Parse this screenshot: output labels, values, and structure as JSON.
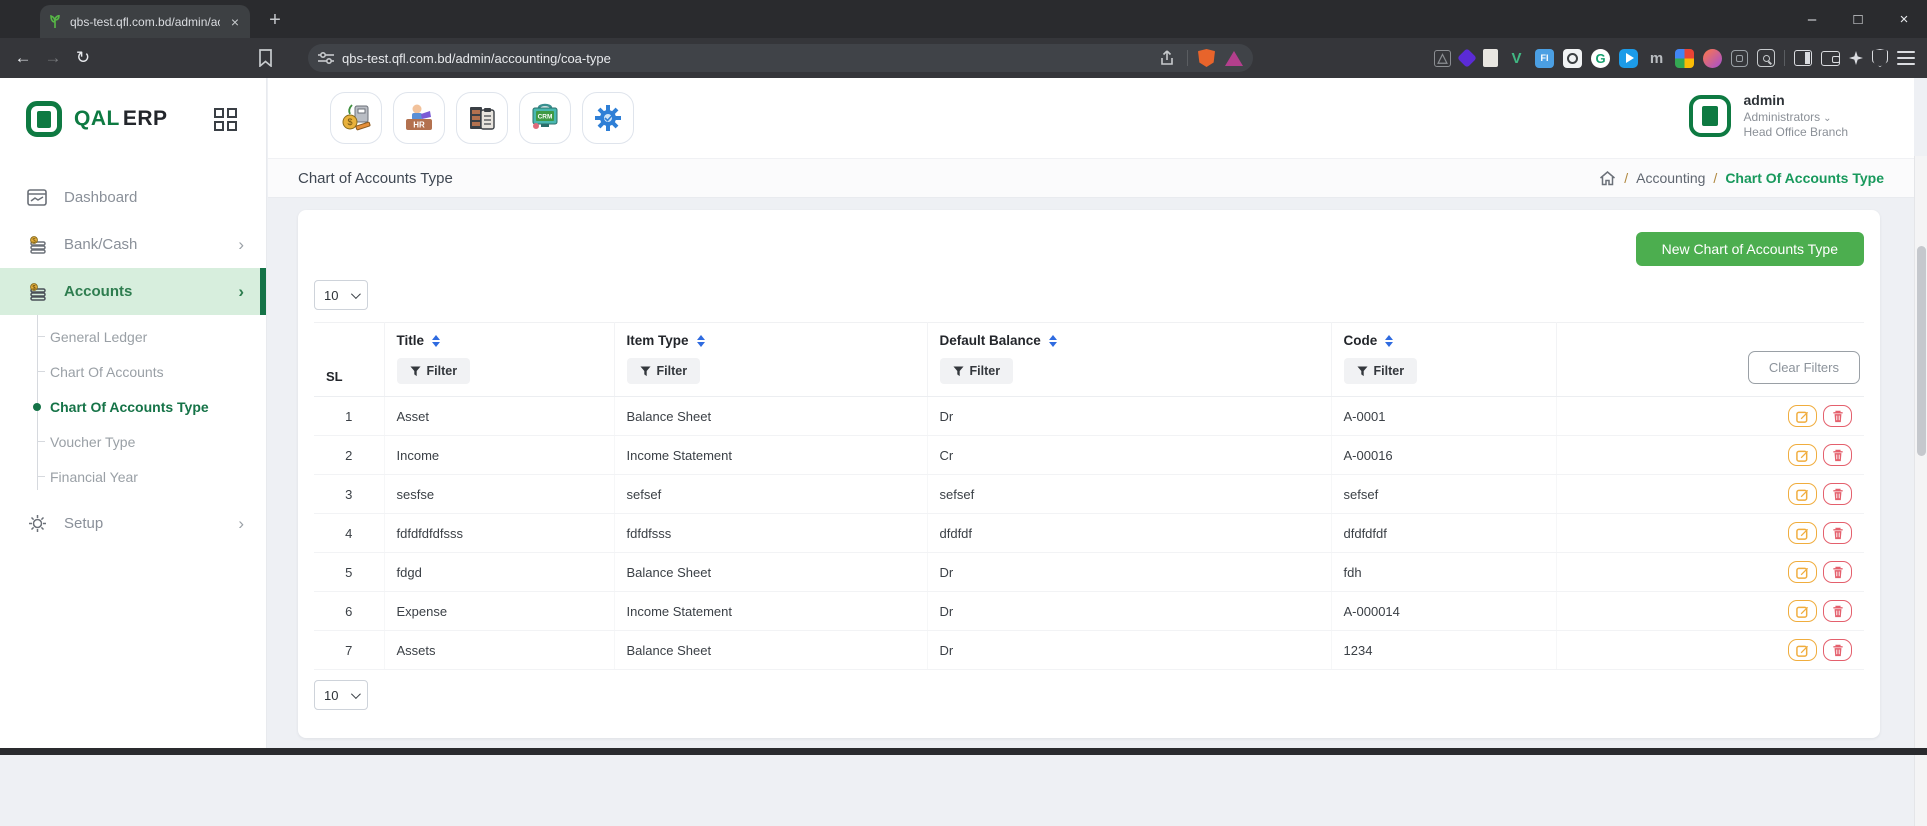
{
  "colors": {
    "brand_green": "#0e7a42",
    "accent_green": "#4cae4f",
    "active_menu_bg": "#d7eedd",
    "link_green": "#18995c",
    "sort_blue": "#2f6be0",
    "edit_orange": "#f0ad3e",
    "delete_red": "#e4606d"
  },
  "browser": {
    "tab_title": "qbs-test.qfl.com.bd/admin/accou",
    "tab_close_glyph": "×",
    "new_tab_glyph": "+",
    "url": "qbs-test.qfl.com.bd/admin/accounting/coa-type",
    "nav": {
      "back": "←",
      "forward": "→",
      "reload": "↻"
    },
    "window_controls": {
      "minimize": "–",
      "maximize": "□",
      "close": "×"
    },
    "extensions": {
      "vue": "V",
      "fi": "FI",
      "grammarly": "G",
      "m": "m"
    }
  },
  "sidebar": {
    "logo_qal": "QAL",
    "logo_erp": "ERP",
    "items": [
      {
        "label": "Dashboard"
      },
      {
        "label": "Bank/Cash",
        "chevron": "›"
      },
      {
        "label": "Accounts",
        "chevron": "›"
      }
    ],
    "submenu": [
      {
        "label": "General Ledger"
      },
      {
        "label": "Chart Of Accounts"
      },
      {
        "label": "Chart Of Accounts Type"
      },
      {
        "label": "Voucher Type"
      },
      {
        "label": "Financial Year"
      }
    ],
    "setup": {
      "label": "Setup",
      "chevron": "›"
    }
  },
  "header": {
    "modules": {
      "hr_label": "HR",
      "crm_label": "CRM"
    },
    "user": {
      "name": "admin",
      "role": "Administrators",
      "role_chevron": "⌄",
      "branch": "Head Office Branch"
    }
  },
  "page": {
    "title": "Chart of Accounts Type",
    "breadcrumb": {
      "sep": "/",
      "level1": "Accounting",
      "current": "Chart Of Accounts Type"
    }
  },
  "card": {
    "new_button": "New Chart of Accounts Type",
    "page_size": "10",
    "clear_filters": "Clear Filters"
  },
  "table": {
    "filter_label": "Filter",
    "headers": {
      "sl": "SL",
      "title": "Title",
      "item_type": "Item Type",
      "default_balance": "Default Balance",
      "code": "Code"
    },
    "rows": [
      {
        "sl": "1",
        "title": "Asset",
        "item_type": "Balance Sheet",
        "default_balance": "Dr",
        "code": "A-0001"
      },
      {
        "sl": "2",
        "title": "Income",
        "item_type": "Income Statement",
        "default_balance": "Cr",
        "code": "A-00016"
      },
      {
        "sl": "3",
        "title": "sesfse",
        "item_type": "sefsef",
        "default_balance": "sefsef",
        "code": "sefsef"
      },
      {
        "sl": "4",
        "title": "fdfdfdfdfsss",
        "item_type": "fdfdfsss",
        "default_balance": "dfdfdf",
        "code": "dfdfdfdf"
      },
      {
        "sl": "5",
        "title": "fdgd",
        "item_type": "Balance Sheet",
        "default_balance": "Dr",
        "code": "fdh"
      },
      {
        "sl": "6",
        "title": "Expense",
        "item_type": "Income Statement",
        "default_balance": "Dr",
        "code": "A-000014"
      },
      {
        "sl": "7",
        "title": "Assets",
        "item_type": "Balance Sheet",
        "default_balance": "Dr",
        "code": "1234"
      }
    ]
  }
}
